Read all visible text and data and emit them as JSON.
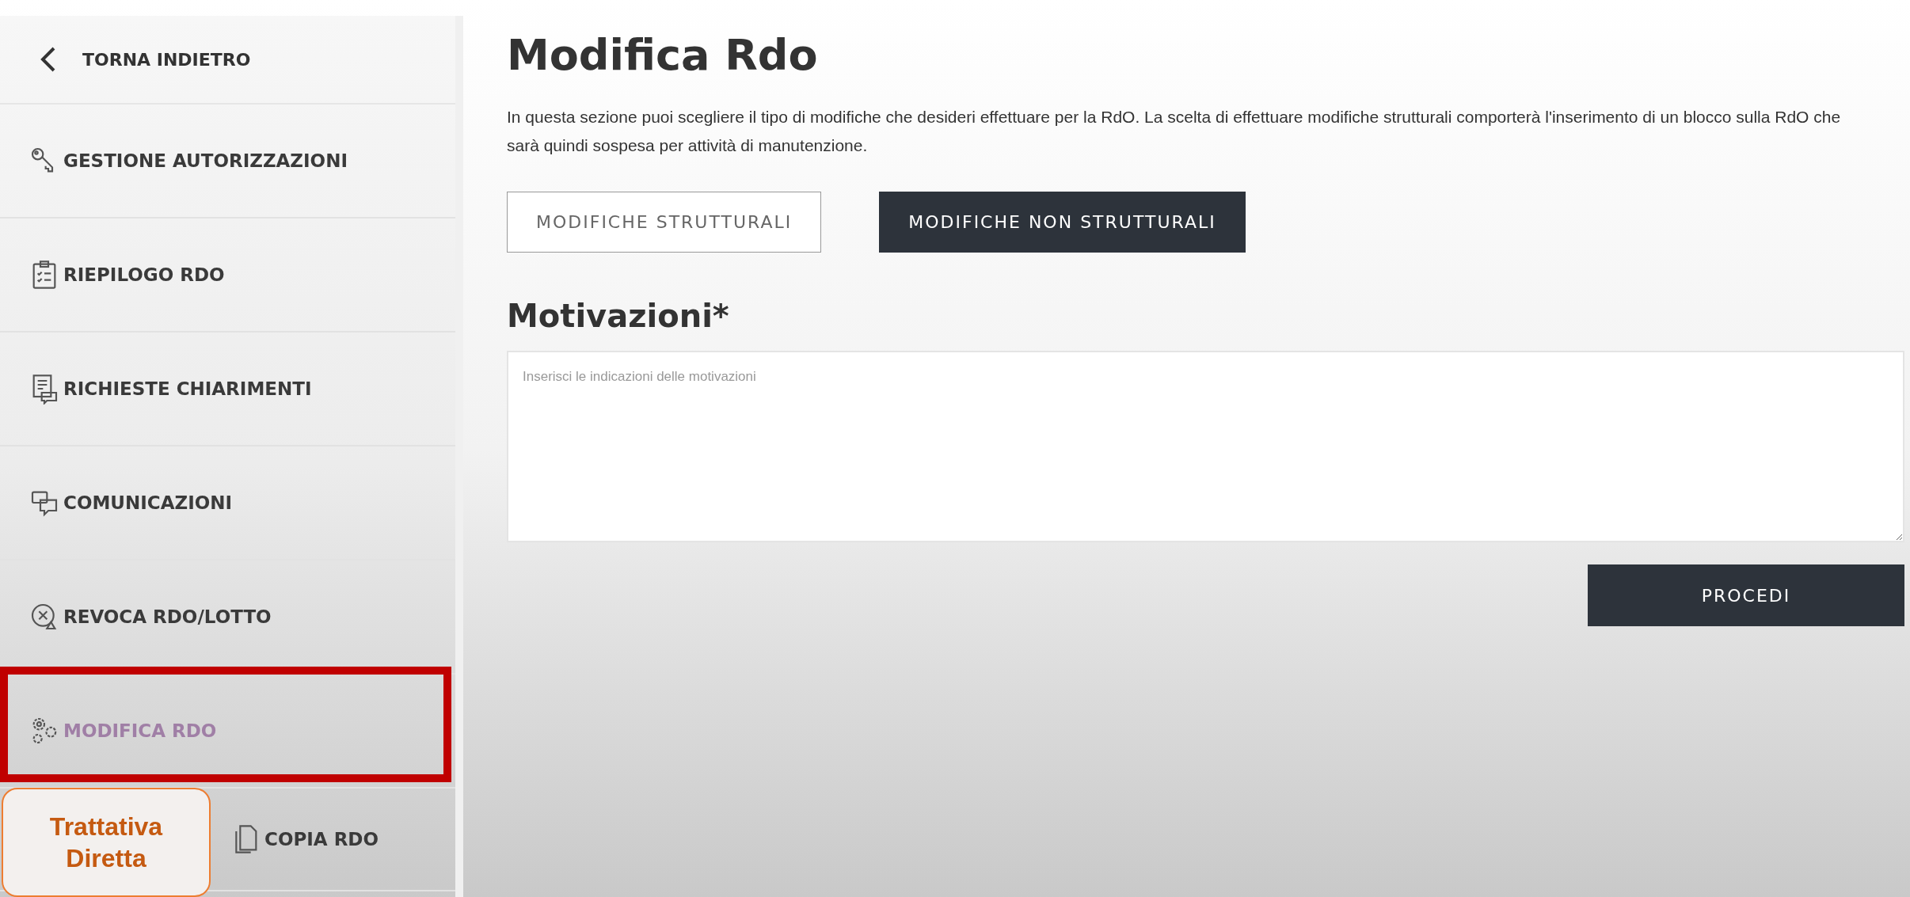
{
  "sidebar": {
    "back": {
      "label": "TORNA INDIETRO"
    },
    "items": [
      {
        "label": "GESTIONE AUTORIZZAZIONI",
        "selected": false
      },
      {
        "label": "RIEPILOGO RDO",
        "selected": false
      },
      {
        "label": "RICHIESTE CHIARIMENTI",
        "selected": false
      },
      {
        "label": "COMUNICAZIONI",
        "selected": false
      },
      {
        "label": "REVOCA RDO/LOTTO",
        "selected": false
      },
      {
        "label": "MODIFICA RDO",
        "selected": true
      },
      {
        "label": "COPIA RDO",
        "selected": false
      }
    ]
  },
  "annotation": {
    "text": "Trattativa Diretta"
  },
  "main": {
    "title": "Modifica Rdo",
    "description": "In questa sezione puoi scegliere il tipo di modifiche che desideri effettuare per la RdO. La scelta di effettuare modifiche strutturali comporterà l'inserimento di un blocco sulla RdO che sarà quindi sospesa per attività di manutenzione.",
    "options": [
      {
        "label": "MODIFICHE STRUTTURALI",
        "selected": false
      },
      {
        "label": "MODIFICHE NON STRUTTURALI",
        "selected": true
      }
    ],
    "reasons": {
      "heading": "Motivazioni*",
      "placeholder": "Inserisci le indicazioni delle motivazioni"
    },
    "submit": "PROCEDI"
  }
}
